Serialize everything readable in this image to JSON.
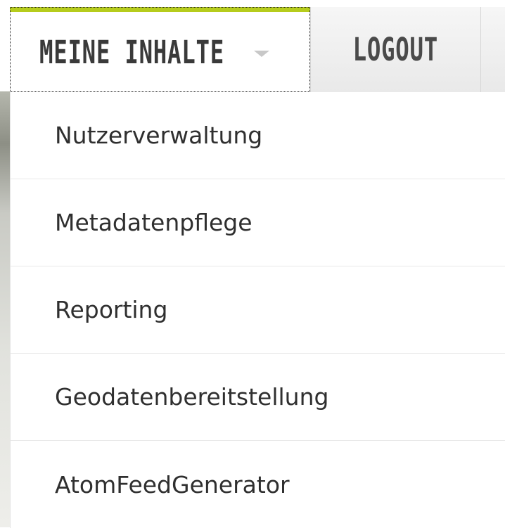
{
  "nav": {
    "my_content_label": "MEINE INHALTE",
    "logout_label": "LOGOUT",
    "accent_color": "#b6cc1c",
    "caret_icon": "caret-down-icon"
  },
  "dropdown": {
    "items": [
      {
        "label": "Nutzerverwaltung"
      },
      {
        "label": "Metadatenpflege"
      },
      {
        "label": "Reporting"
      },
      {
        "label": "Geodatenbereitstellung"
      },
      {
        "label": "AtomFeedGenerator"
      }
    ]
  }
}
